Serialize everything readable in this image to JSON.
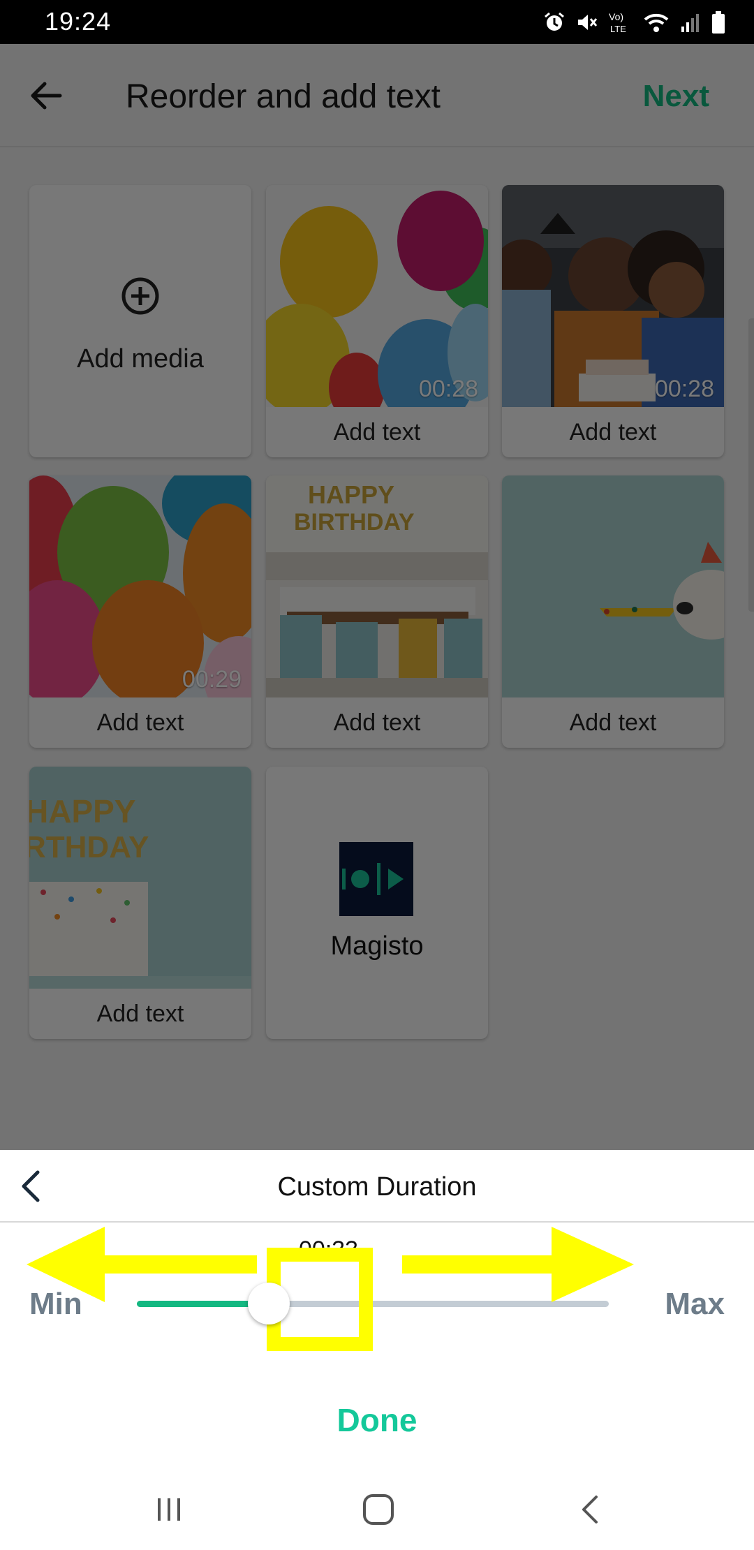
{
  "status_bar": {
    "time": "19:24",
    "icons": [
      "alarm-icon",
      "mute-icon",
      "volte-icon",
      "wifi-icon",
      "signal-icon",
      "battery-icon"
    ],
    "volte_label_top": "Vo)",
    "volte_label_bottom": "LTE"
  },
  "header": {
    "title": "Reorder and add text",
    "next_label": "Next",
    "back_icon": "back-arrow-icon"
  },
  "grid": {
    "add_media": {
      "label": "Add media",
      "icon": "plus-circle-icon"
    },
    "items": [
      {
        "name": "balloons-clip",
        "duration": "00:28",
        "caption": "Add text"
      },
      {
        "name": "family-birthday-clip",
        "duration": "00:28",
        "caption": "Add text"
      },
      {
        "name": "balloons-closeup-clip",
        "duration": "00:29",
        "caption": "Add text"
      },
      {
        "name": "dining-room-photo",
        "duration": "",
        "caption": "Add text"
      },
      {
        "name": "dog-party-horn-photo",
        "duration": "",
        "caption": "Add text"
      },
      {
        "name": "birthday-cake-photo",
        "duration": "",
        "caption": "Add text"
      }
    ],
    "thumb_texts": {
      "banner_top": "HAPPY",
      "banner_bottom": "BIRTHDAY",
      "cake_top": "HAPPY",
      "cake_bottom": "RTHDAY"
    },
    "outro": {
      "label": "Magisto",
      "icon": "magisto-logo-icon"
    }
  },
  "sheet": {
    "title": "Custom Duration",
    "back_icon": "chevron-left-icon",
    "value": "00:33",
    "min_label": "Min",
    "max_label": "Max",
    "slider_fraction": 0.28,
    "done_label": "Done",
    "accent": "#14b881",
    "annotation_color": "#ffff00"
  },
  "nav": {
    "icons": [
      "recent-apps-icon",
      "home-icon",
      "back-icon"
    ]
  }
}
